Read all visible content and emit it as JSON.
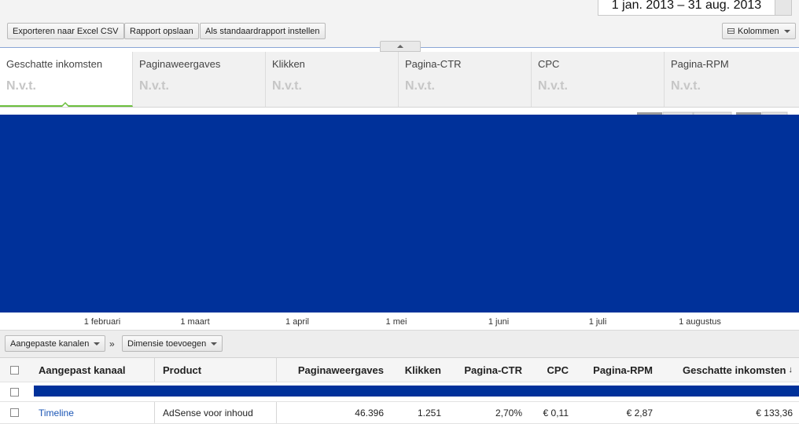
{
  "toolbar": {
    "date_range": "1 jan. 2013 – 31 aug. 2013",
    "export_csv": "Exporteren naar Excel CSV",
    "save_report": "Rapport opslaan",
    "set_default": "Als standaardrapport instellen",
    "columns": "Kolommen"
  },
  "metrics": [
    {
      "label": "Geschatte inkomsten",
      "value": "N.v.t."
    },
    {
      "label": "Paginaweergaves",
      "value": "N.v.t."
    },
    {
      "label": "Klikken",
      "value": "N.v.t."
    },
    {
      "label": "Pagina-CTR",
      "value": "N.v.t."
    },
    {
      "label": "CPC",
      "value": "N.v.t."
    },
    {
      "label": "Pagina-RPM",
      "value": "N.v.t."
    }
  ],
  "chart": {
    "color": "#00319a",
    "x_ticks": [
      "1 februari",
      "1 maart",
      "1 april",
      "1 mei",
      "1 juni",
      "1 juli",
      "1 augustus"
    ]
  },
  "filters": {
    "channels": "Aangepaste kanalen",
    "separator": "»",
    "add_dimension": "Dimensie toevoegen"
  },
  "table": {
    "headers": {
      "channel": "Aangepast kanaal",
      "product": "Product",
      "pageviews": "Paginaweergaves",
      "clicks": "Klikken",
      "ctr": "Pagina-CTR",
      "cpc": "CPC",
      "rpm": "Pagina-RPM",
      "earnings": "Geschatte inkomsten",
      "sort_icon": "↓"
    },
    "rows": [
      {
        "channel": "Timeline",
        "product": "AdSense voor inhoud",
        "pageviews": "46.396",
        "clicks": "1.251",
        "ctr": "2,70%",
        "cpc": "€ 0,11",
        "rpm": "€ 2,87",
        "earnings": "€ 133,36"
      }
    ]
  },
  "colors": {
    "accent_blue": "#00319a",
    "active_tab_underline": "#6cbf3e",
    "link": "#1a55b5"
  }
}
